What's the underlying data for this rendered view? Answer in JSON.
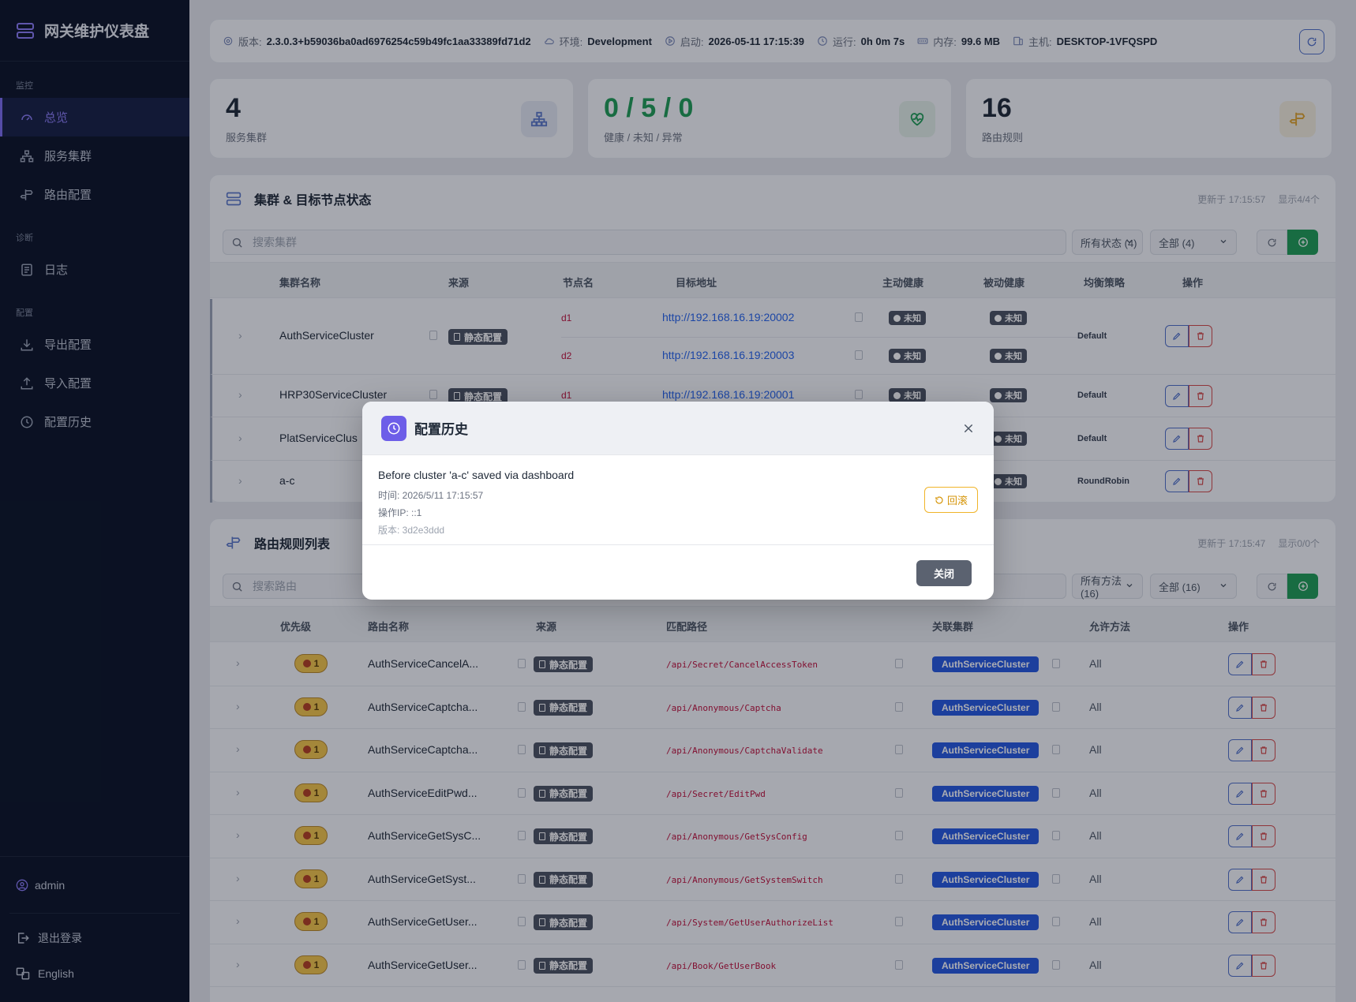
{
  "sidebar": {
    "title": "网关维护仪表盘",
    "sections": [
      {
        "title": "监控",
        "items": [
          "总览",
          "服务集群",
          "路由配置"
        ]
      },
      {
        "title": "诊断",
        "items": [
          "日志"
        ]
      },
      {
        "title": "配置",
        "items": [
          "导出配置",
          "导入配置",
          "配置历史"
        ]
      }
    ],
    "user": "admin",
    "logout": "退出登录",
    "language": "English"
  },
  "infobar": {
    "version_label": "版本:",
    "version": "2.3.0.3+b59036ba0ad6976254c59b49fc1aa33389fd71d2",
    "env_label": "环境:",
    "env": "Development",
    "start_label": "启动:",
    "start": "2026-05-11 17:15:39",
    "uptime_label": "运行:",
    "uptime": "0h 0m 7s",
    "memory_label": "内存:",
    "memory": "99.6 MB",
    "host_label": "主机:",
    "host": "DESKTOP-1VFQSPD"
  },
  "stats": {
    "clusters": {
      "value": "4",
      "label": "服务集群"
    },
    "health": {
      "value": "0 / 5 / 0",
      "label": "健康 / 未知 / 异常"
    },
    "routes": {
      "value": "16",
      "label": "路由规则"
    }
  },
  "cluster_section": {
    "title": "集群 & 目标节点状态",
    "updated": "更新于 17:15:57",
    "shown": "显示4/4个",
    "search_placeholder": "搜索集群",
    "filter_status": "所有状态 (4)",
    "filter_all": "全部 (4)",
    "headers": [
      "集群名称",
      "来源",
      "节点名",
      "目标地址",
      "主动健康",
      "被动健康",
      "均衡策略",
      "操作"
    ],
    "rows": [
      {
        "name": "AuthServiceCluster",
        "source": "静态配置",
        "nodes": [
          {
            "node": "d1",
            "addr": "http://192.168.16.19:20002",
            "active": "未知",
            "passive": "未知"
          },
          {
            "node": "d2",
            "addr": "http://192.168.16.19:20003",
            "active": "未知",
            "passive": "未知"
          }
        ],
        "policy": "Default"
      },
      {
        "name": "HRP30ServiceCluster",
        "source": "静态配置",
        "nodes": [
          {
            "node": "d1",
            "addr": "http://192.168.16.19:20001",
            "active": "未知",
            "passive": "未知"
          }
        ],
        "policy": "Default"
      },
      {
        "name": "PlatServiceClus",
        "passive": "未知",
        "policy": "Default"
      },
      {
        "name": "a-c",
        "passive": "未知",
        "policy": "RoundRobin"
      }
    ]
  },
  "route_section": {
    "title": "路由规则列表",
    "updated": "更新于 17:15:47",
    "shown": "显示0/0个",
    "search_placeholder": "搜索路由",
    "filter_method": "所有方法 (16)",
    "filter_all": "全部 (16)",
    "headers": [
      "优先级",
      "路由名称",
      "来源",
      "匹配路径",
      "关联集群",
      "允许方法",
      "操作"
    ],
    "rows": [
      {
        "priority": "1",
        "name": "AuthServiceCancelA...",
        "source": "静态配置",
        "path": "/api/Secret/CancelAccessToken",
        "cluster": "AuthServiceCluster",
        "methods": "All"
      },
      {
        "priority": "1",
        "name": "AuthServiceCaptcha...",
        "source": "静态配置",
        "path": "/api/Anonymous/Captcha",
        "cluster": "AuthServiceCluster",
        "methods": "All"
      },
      {
        "priority": "1",
        "name": "AuthServiceCaptcha...",
        "source": "静态配置",
        "path": "/api/Anonymous/CaptchaValidate",
        "cluster": "AuthServiceCluster",
        "methods": "All"
      },
      {
        "priority": "1",
        "name": "AuthServiceEditPwd...",
        "source": "静态配置",
        "path": "/api/Secret/EditPwd",
        "cluster": "AuthServiceCluster",
        "methods": "All"
      },
      {
        "priority": "1",
        "name": "AuthServiceGetSysC...",
        "source": "静态配置",
        "path": "/api/Anonymous/GetSysConfig",
        "cluster": "AuthServiceCluster",
        "methods": "All"
      },
      {
        "priority": "1",
        "name": "AuthServiceGetSyst...",
        "source": "静态配置",
        "path": "/api/Anonymous/GetSystemSwitch",
        "cluster": "AuthServiceCluster",
        "methods": "All"
      },
      {
        "priority": "1",
        "name": "AuthServiceGetUser...",
        "source": "静态配置",
        "path": "/api/System/GetUserAuthorizeList",
        "cluster": "AuthServiceCluster",
        "methods": "All"
      },
      {
        "priority": "1",
        "name": "AuthServiceGetUser...",
        "source": "静态配置",
        "path": "/api/Book/GetUserBook",
        "cluster": "AuthServiceCluster",
        "methods": "All"
      }
    ]
  },
  "modal": {
    "title": "配置历史",
    "entry_title": "Before cluster 'a-c' saved via dashboard",
    "time": "时间: 2026/5/11 17:15:57",
    "ip": "操作IP: ::1",
    "version": "版本: 3d2e3ddd",
    "rollback": "回滚",
    "close": "关闭"
  },
  "colors": {
    "accent": "#7c6cf0",
    "sidebar_bg": "#0b1326",
    "success": "#1f9d55",
    "cluster_tag": "#2559e0",
    "danger": "#be123c",
    "warning": "#f0b429"
  }
}
